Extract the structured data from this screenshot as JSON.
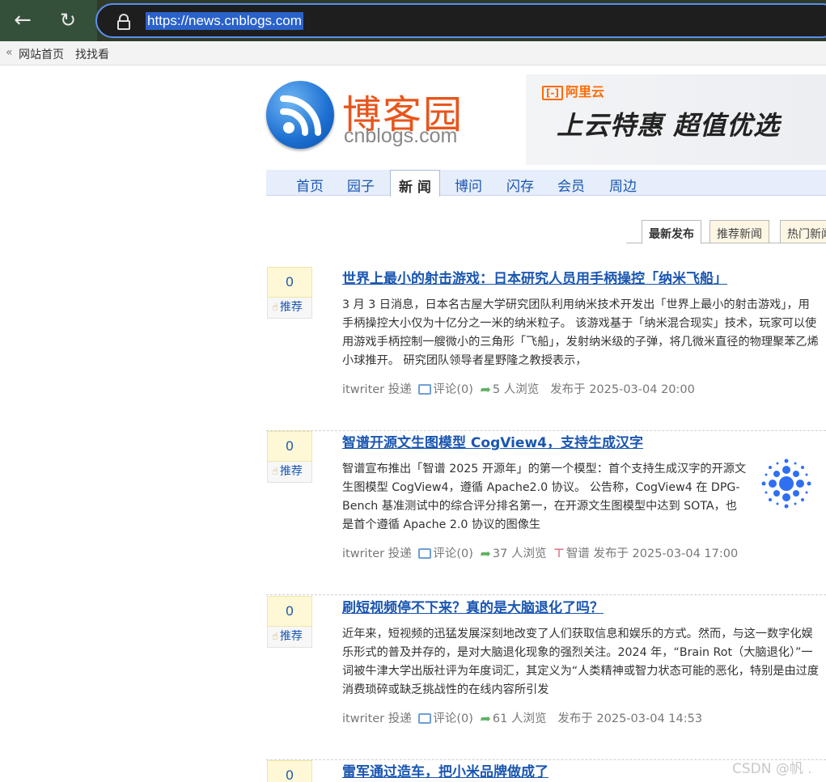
{
  "browser": {
    "url": "https://news.cnblogs.com"
  },
  "top_links": {
    "raquo": "«",
    "home": "网站首页",
    "find": "找找看"
  },
  "logo": {
    "cn": "博客园",
    "en": "cnblogs.com"
  },
  "ad": {
    "brand": "阿里云",
    "brand_mark": "[-]",
    "title": "上云特惠 超值优选"
  },
  "nav": {
    "items": [
      "首页",
      "园子",
      "新 闻",
      "博问",
      "闪存",
      "会员",
      "周边"
    ]
  },
  "tabs": {
    "latest": "最新发布",
    "recommend": "推荐新闻",
    "hot": "热门新闻"
  },
  "news": [
    {
      "digg": "0",
      "digg_label": "推荐",
      "title": "世界上最小的射击游戏：日本研究人员用手柄操控「纳米飞船」",
      "body": "3 月 3 日消息，日本名古屋大学研究团队利用纳米技术开发出「世界上最小的射击游戏」，用手柄操控大小仅为十亿分之一米的纳米粒子。 该游戏基于「纳米混合现实」技术，玩家可以使用游戏手柄控制一艘微小的三角形「飞船」，发射纳米级的子弹，将几微米直径的物理聚苯乙烯小球推开。 研究团队领导者星野隆之教授表示，",
      "author": "itwriter 投递",
      "comments": "评论(0)",
      "views": "5 人浏览",
      "tag": "",
      "published": "发布于 2025-03-04 20:00"
    },
    {
      "digg": "0",
      "digg_label": "推荐",
      "title": "智谱开源文生图模型 CogView4，支持生成汉字",
      "body": "智谱宣布推出「智谱 2025 开源年」的第一个模型：首个支持生成汉字的开源文生图模型 CogView4，遵循 Apache2.0 协议。 公告称，CogView4 在 DPG-Bench 基准测试中的综合评分排名第一，在开源文生图模型中达到 SOTA，也是首个遵循 Apache 2.0 协议的图像生",
      "author": "itwriter 投递",
      "comments": "评论(0)",
      "views": "37 人浏览",
      "tag": "智谱",
      "published": "发布于 2025-03-04 17:00"
    },
    {
      "digg": "0",
      "digg_label": "推荐",
      "title": "刷短视频停不下来？真的是大脑退化了吗？",
      "body": "近年来，短视频的迅猛发展深刻地改变了人们获取信息和娱乐的方式。然而，与这一数字化娱乐形式的普及并存的，是对大脑退化现象的强烈关注。2024 年，“Brain Rot（大脑退化）”一词被牛津大学出版社评为年度词汇，其定义为“人类精神或智力状态可能的恶化，特别是由过度消费琐碎或缺乏挑战性的在线内容所引发",
      "author": "itwriter 投递",
      "comments": "评论(0)",
      "views": "61 人浏览",
      "tag": "",
      "published": "发布于 2025-03-04 14:53"
    },
    {
      "digg": "0",
      "title": "雷军通过造车，把小米品牌做成了"
    }
  ],
  "watermark": "CSDN @帆 .",
  "colors": {
    "link": "#1a56b0",
    "logo_orange": "#e8551c",
    "ad_orange": "#ff6a00"
  }
}
